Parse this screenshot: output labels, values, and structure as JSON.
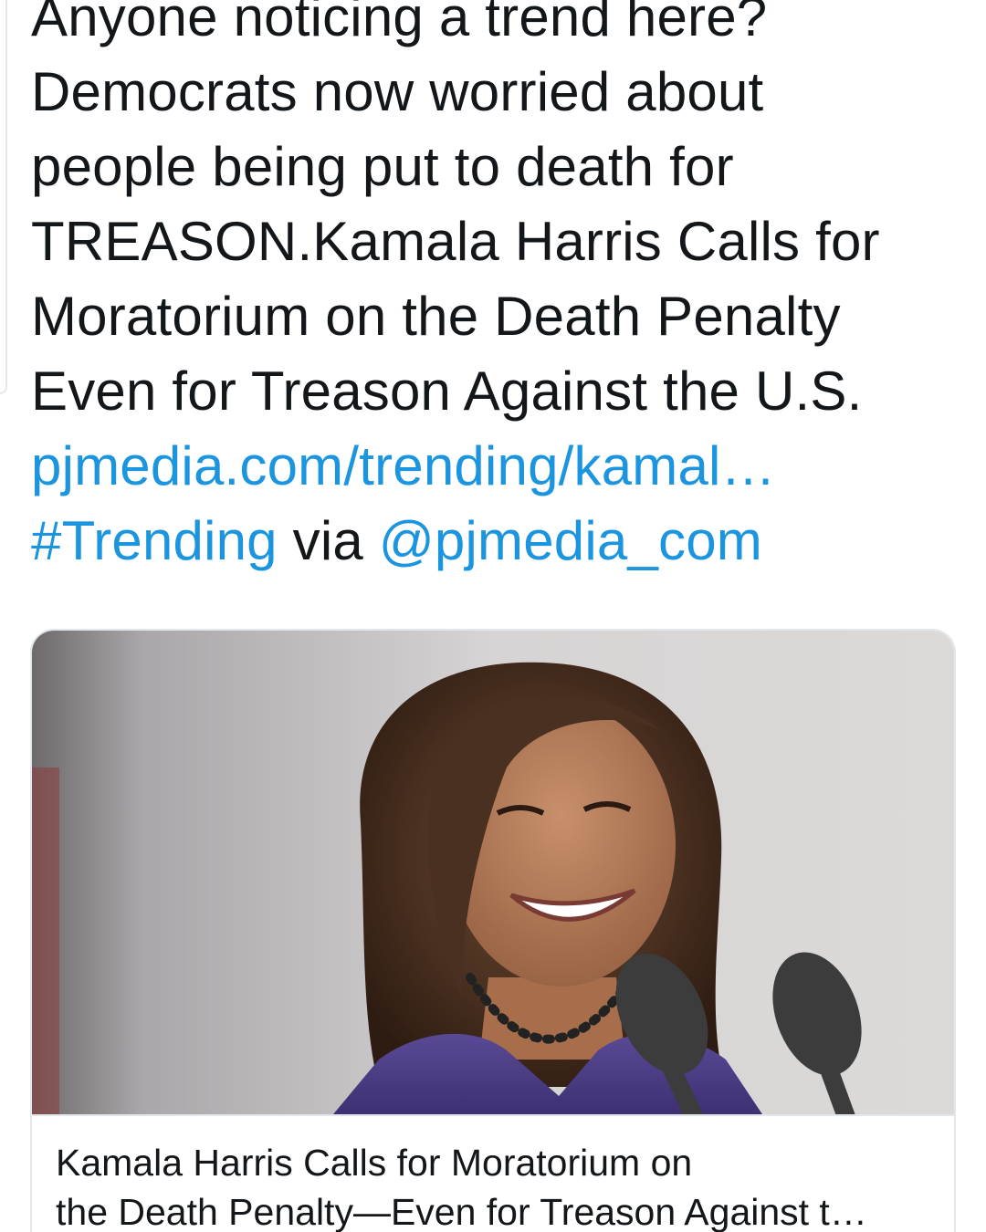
{
  "tweet": {
    "lines": [
      "Anyone noticing a trend here?",
      "Democrats now worried about",
      "people being put to death for",
      "TREASON.Kamala Harris Calls for",
      "Moratorium on the Death Penalty",
      "Even for Treason Against the U.S."
    ],
    "link_url_text": "pjmedia.com/trending/kamal…",
    "hashtag": "#Trending",
    "via_text": "via",
    "mention": "@pjmedia_com"
  },
  "card": {
    "image_alt": "Kamala Harris smiling at a podium with microphones",
    "title_line_1": "Kamala Harris Calls for Moratorium on",
    "title_line_2": "the Death Penalty—Even for Treason Against t…"
  },
  "colors": {
    "link": "#1b95e0",
    "text": "#14171a",
    "border": "#e1e8ed"
  }
}
